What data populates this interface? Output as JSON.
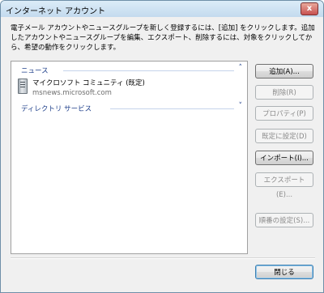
{
  "window": {
    "title": "インターネット アカウント",
    "close_glyph": "x"
  },
  "instruction": "電子メール アカウントやニュースグループを新しく登録するには、[追加] をクリックします。追加したアカウントやニュースグループを編集、エクスポート、削除するには、対象をクリックしてから、希望の動作をクリックします。",
  "list": {
    "groups": [
      {
        "label": "ニュース",
        "chevron": "˄"
      },
      {
        "label": "ディレクトリ サービス",
        "chevron": "˅"
      }
    ],
    "accounts": [
      {
        "name": "マイクロソフト コミュニティ (既定)",
        "server": "msnews.microsoft.com",
        "icon": "server-icon"
      }
    ]
  },
  "buttons": {
    "add": "追加(A)...",
    "remove": "削除(R)",
    "properties": "プロパティ(P)",
    "set_default": "既定に設定(D)",
    "import": "インポート(I)...",
    "export": "エクスポート(E)...",
    "order": "順番の設定(S)...",
    "close": "閉じる"
  }
}
